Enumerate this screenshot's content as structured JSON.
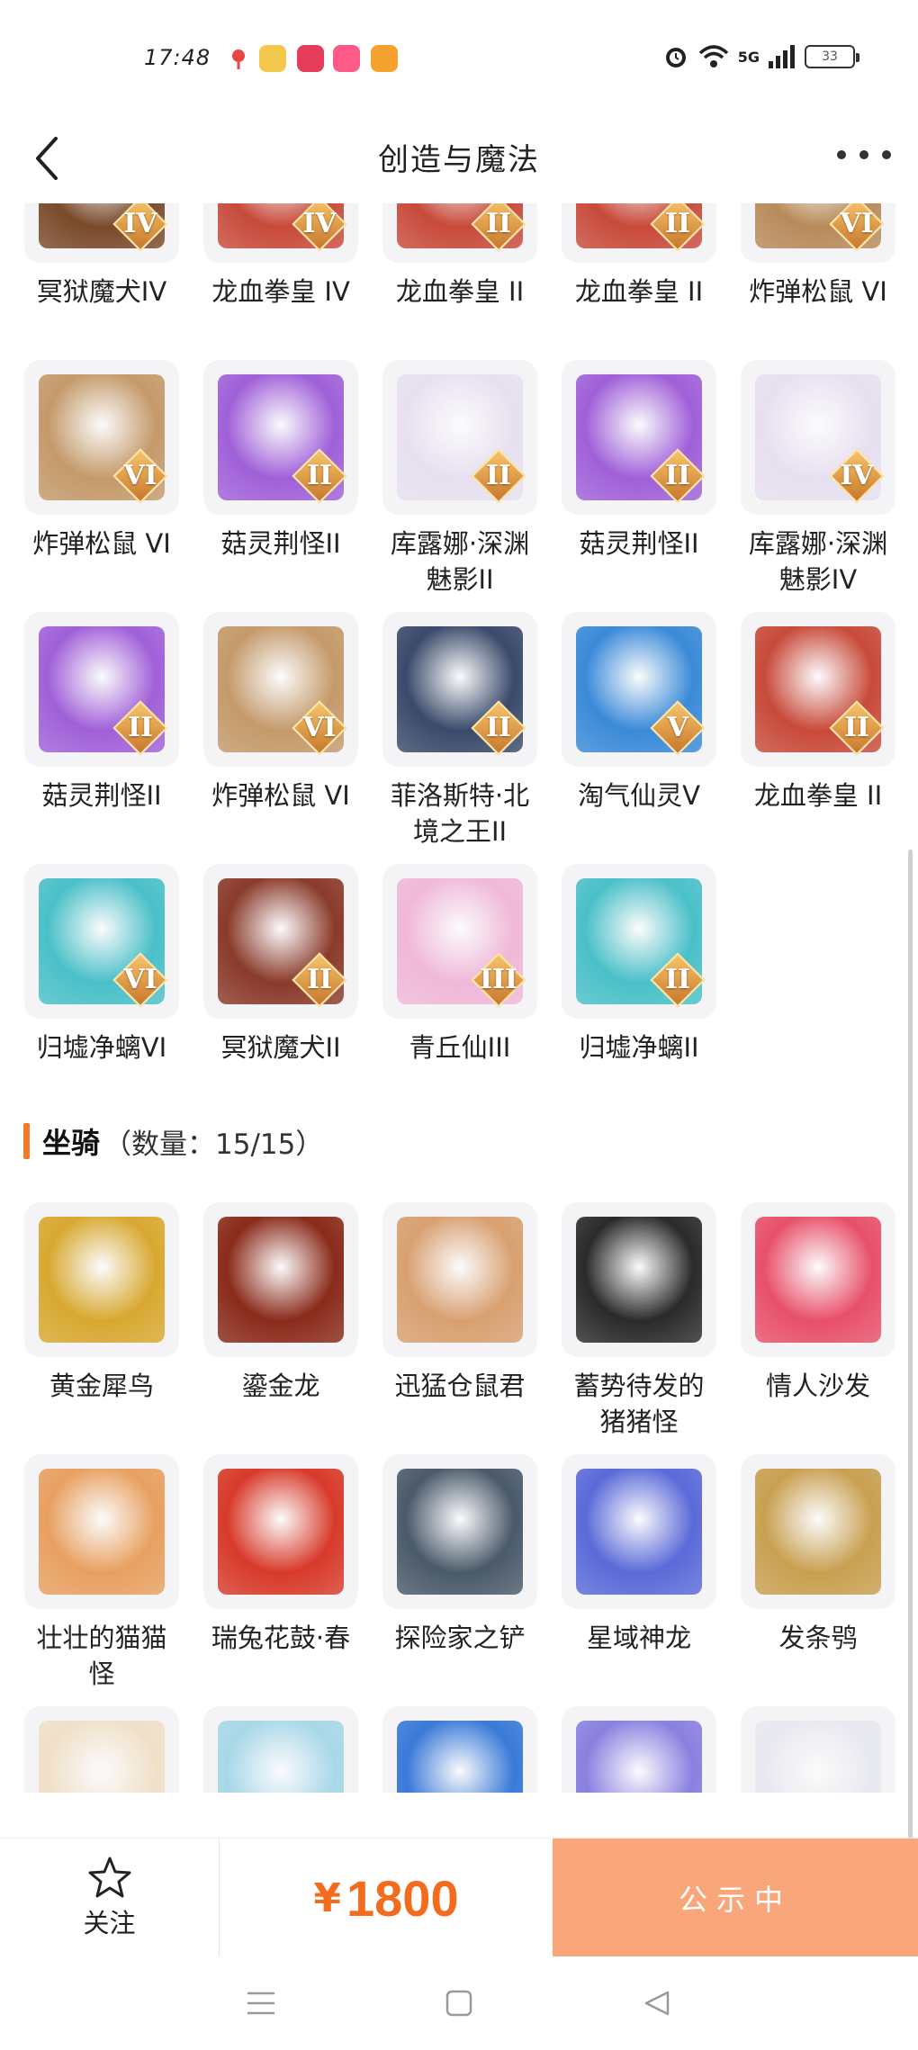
{
  "status_bar": {
    "time": "17:48",
    "network": "5G",
    "battery": "33",
    "app_icon_colors": [
      "#e84545",
      "#f2c94c",
      "#e63c5a",
      "#ff5a87",
      "#f4a22d"
    ]
  },
  "nav": {
    "title": "创造与魔法"
  },
  "pets_grid": [
    {
      "label": "冥狱魔犬IV",
      "badge": "IV",
      "color": "#7a4a2a"
    },
    {
      "label": "龙血拳皇 IV",
      "badge": "IV",
      "color": "#c84a3a"
    },
    {
      "label": "龙血拳皇 II",
      "badge": "II",
      "color": "#c84a3a"
    },
    {
      "label": "龙血拳皇 II",
      "badge": "II",
      "color": "#c84a3a"
    },
    {
      "label": "炸弹松鼠 VI",
      "badge": "VI",
      "color": "#b88a5a"
    },
    {
      "label": "炸弹松鼠 VI",
      "badge": "VI",
      "color": "#c49a6a"
    },
    {
      "label": "菇灵荆怪II",
      "badge": "II",
      "color": "#a060d8"
    },
    {
      "label": "库露娜·深渊魅影II",
      "badge": "II",
      "color": "#e8e0f0"
    },
    {
      "label": "菇灵荆怪II",
      "badge": "II",
      "color": "#a060d8"
    },
    {
      "label": "库露娜·深渊魅影IV",
      "badge": "IV",
      "color": "#e8e0f0"
    },
    {
      "label": "菇灵荆怪II",
      "badge": "II",
      "color": "#a060d8"
    },
    {
      "label": "炸弹松鼠 VI",
      "badge": "VI",
      "color": "#c49a6a"
    },
    {
      "label": "菲洛斯特·北境之王II",
      "badge": "II",
      "color": "#3a4a6a"
    },
    {
      "label": "淘气仙灵V",
      "badge": "V",
      "color": "#3a8ad8"
    },
    {
      "label": "龙血拳皇 II",
      "badge": "II",
      "color": "#c84a3a"
    },
    {
      "label": "归墟净螭VI",
      "badge": "VI",
      "color": "#4ac0c8"
    },
    {
      "label": "冥狱魔犬II",
      "badge": "II",
      "color": "#8a3a2a"
    },
    {
      "label": "青丘仙III",
      "badge": "III",
      "color": "#f0b8d8"
    },
    {
      "label": "归墟净螭II",
      "badge": "II",
      "color": "#4ac0c8"
    }
  ],
  "mounts_section": {
    "title": "坐骑",
    "count": "（数量：15/15）"
  },
  "mounts_grid": [
    {
      "label": "黄金犀鸟",
      "color": "#d8a830"
    },
    {
      "label": "鎏金龙",
      "color": "#8a2a1a"
    },
    {
      "label": "迅猛仓鼠君",
      "color": "#d8a070"
    },
    {
      "label": "蓄势待发的猪猪怪",
      "color": "#2a2a2a"
    },
    {
      "label": "情人沙发",
      "color": "#e8506a"
    },
    {
      "label": "壮壮的猫猫怪",
      "color": "#e8a060"
    },
    {
      "label": "瑞兔花鼓·春",
      "color": "#d83a2a"
    },
    {
      "label": "探险家之铲",
      "color": "#4a5a6a"
    },
    {
      "label": "星域神龙",
      "color": "#5a6ad8"
    },
    {
      "label": "发条鸮",
      "color": "#c8a050"
    },
    {
      "label": "",
      "color": "#f0e0c8"
    },
    {
      "label": "",
      "color": "#a8d8e8"
    },
    {
      "label": "",
      "color": "#3a7ad8"
    },
    {
      "label": "",
      "color": "#8a80e0"
    },
    {
      "label": "",
      "color": "#e8e8f0"
    }
  ],
  "action_bar": {
    "follow_label": "关注",
    "price_symbol": "¥",
    "price": "1800",
    "status_button": "公示中"
  }
}
